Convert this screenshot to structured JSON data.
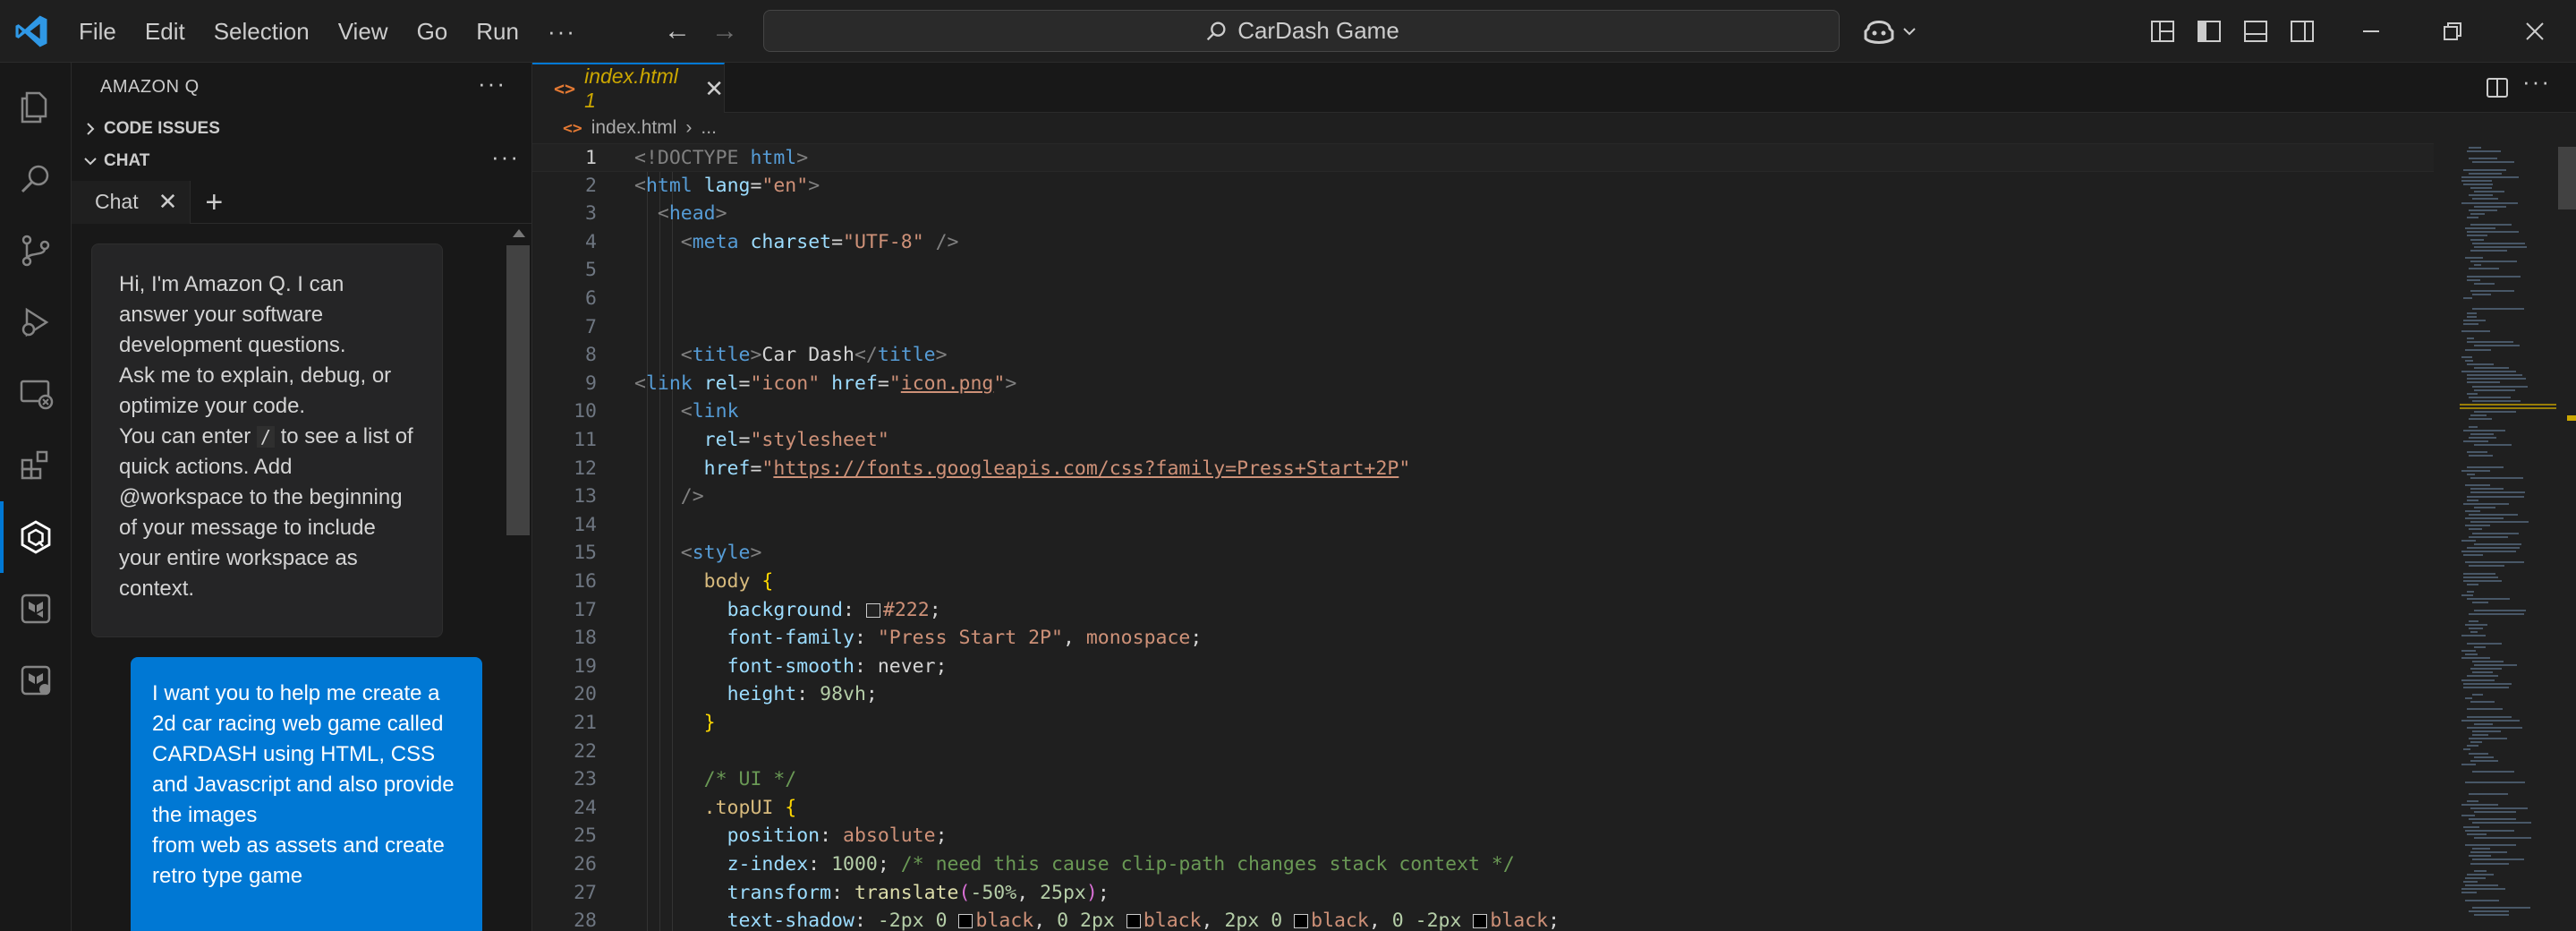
{
  "window": {
    "menu": [
      "File",
      "Edit",
      "Selection",
      "View",
      "Go",
      "Run"
    ],
    "more": "···",
    "search_text": "CarDash Game"
  },
  "sidebar": {
    "title": "AMAZON Q",
    "title_more": "···",
    "sections": [
      {
        "label": "CODE ISSUES",
        "expanded": false
      },
      {
        "label": "CHAT",
        "expanded": true
      }
    ],
    "chat_tab_label": "Chat",
    "add_tab": "+",
    "q_message": [
      "Hi, I'm Amazon Q. I can answer your software development questions.",
      "Ask me to explain, debug, or optimize your code.",
      "You can enter",
      "/",
      "to see a list of quick actions. Add @workspace to the beginning of your message to include your entire workspace as context."
    ],
    "user_message": [
      "I want you to help me create a 2d car racing web game called CARDASH using HTML, CSS and Javascript and also provide the images",
      "from web as assets and create retro type game"
    ]
  },
  "editor": {
    "tab": {
      "name": "index.html",
      "badge": "1",
      "modified_warning": true
    },
    "breadcrumb": [
      "index.html",
      "..."
    ],
    "current_line": 1,
    "lines": [
      {
        "n": "1",
        "html": "<span class='t-doc'>&lt;!DOCTYPE </span><span class='t-tag'>html</span><span class='t-doc'>&gt;</span>"
      },
      {
        "n": "2",
        "html": "<span class='t-punc'>&lt;</span><span class='t-tag'>html</span> <span class='t-attr'>lang</span>=<span class='t-str'>\"en\"</span><span class='t-punc'>&gt;</span>"
      },
      {
        "n": "3",
        "html": "  <span class='t-punc'>&lt;</span><span class='t-tag'>head</span><span class='t-punc'>&gt;</span>"
      },
      {
        "n": "4",
        "html": "    <span class='t-punc'>&lt;</span><span class='t-tag'>meta</span> <span class='t-attr'>charset</span>=<span class='t-str'>\"UTF-8\"</span> <span class='t-punc'>/&gt;</span>"
      },
      {
        "n": "5",
        "html": ""
      },
      {
        "n": "6",
        "html": ""
      },
      {
        "n": "7",
        "html": ""
      },
      {
        "n": "8",
        "html": "    <span class='t-punc'>&lt;</span><span class='t-tag'>title</span><span class='t-punc'>&gt;</span>Car Dash<span class='t-punc'>&lt;/</span><span class='t-tag'>title</span><span class='t-punc'>&gt;</span>"
      },
      {
        "n": "9",
        "html": "<span class='t-punc'>&lt;</span><span class='t-tag'>link</span> <span class='t-attr'>rel</span>=<span class='t-str'>\"icon\"</span> <span class='t-attr'>href</span>=<span class='t-str'>\"</span><span class='t-url'>icon.png</span><span class='t-str'>\"</span><span class='t-punc'>&gt;</span>"
      },
      {
        "n": "10",
        "html": "    <span class='t-punc'>&lt;</span><span class='t-tag'>link</span>"
      },
      {
        "n": "11",
        "html": "      <span class='t-attr'>rel</span>=<span class='t-str'>\"stylesheet\"</span>"
      },
      {
        "n": "12",
        "html": "      <span class='t-attr'>href</span>=<span class='t-str'>\"</span><span class='t-url'>https://fonts.googleapis.com/css?family=Press+Start+2P</span><span class='t-str'>\"</span>"
      },
      {
        "n": "13",
        "html": "    <span class='t-punc'>/&gt;</span>"
      },
      {
        "n": "14",
        "html": ""
      },
      {
        "n": "15",
        "html": "    <span class='t-punc'>&lt;</span><span class='t-tag'>style</span><span class='t-punc'>&gt;</span>"
      },
      {
        "n": "16",
        "html": "      <span class='t-sel'>body</span> <span class='t-brace'>{</span>"
      },
      {
        "n": "17",
        "html": "        <span class='t-prop'>background</span>: <span class='swatch' style='background:#222'></span><span class='t-str'>#222</span>;"
      },
      {
        "n": "18",
        "html": "        <span class='t-prop'>font-family</span>: <span class='t-str'>\"Press Start 2P\"</span>, <span class='t-str'>monospace</span>;"
      },
      {
        "n": "19",
        "html": "        <span class='t-prop'>font-smooth</span>: never;"
      },
      {
        "n": "20",
        "html": "        <span class='t-prop'>height</span>: <span class='t-num'>98vh</span>;"
      },
      {
        "n": "21",
        "html": "      <span class='t-brace'>}</span>"
      },
      {
        "n": "22",
        "html": ""
      },
      {
        "n": "23",
        "html": "      <span class='t-com'>/* UI */</span>"
      },
      {
        "n": "24",
        "html": "      <span class='t-sel'>.topUI</span> <span class='t-brace'>{</span>"
      },
      {
        "n": "25",
        "html": "        <span class='t-prop'>position</span>: <span class='t-str'>absolute</span>;"
      },
      {
        "n": "26",
        "html": "        <span class='t-prop'>z-index</span>: <span class='t-num'>1000</span>; <span class='t-com'>/* need this cause clip-path changes stack context */</span>"
      },
      {
        "n": "27",
        "html": "        <span class='t-prop'>transform</span>: <span class='t-fn'>translate</span><span class='t-paren'>(</span><span class='t-num'>-50%</span>, <span class='t-num'>25px</span><span class='t-paren'>)</span>;"
      },
      {
        "n": "28",
        "html": "        <span class='t-prop'>text-shadow</span>: <span class='t-num'>-2px</span> <span class='t-num'>0</span> <span class='swatch' style='background:#000'></span><span class='t-str'>black</span>, <span class='t-num'>0</span> <span class='t-num'>2px</span> <span class='swatch' style='background:#000'></span><span class='t-str'>black</span>, <span class='t-num'>2px</span> <span class='t-num'>0</span> <span class='swatch' style='background:#000'></span><span class='t-str'>black</span>, <span class='t-num'>0</span> <span class='t-num'>-2px</span> <span class='swatch' style='background:#000'></span><span class='t-str'>black</span>;"
      }
    ]
  },
  "colors": {
    "accent": "#0078d4",
    "warning": "#cca700",
    "html_icon": "#e37933"
  }
}
